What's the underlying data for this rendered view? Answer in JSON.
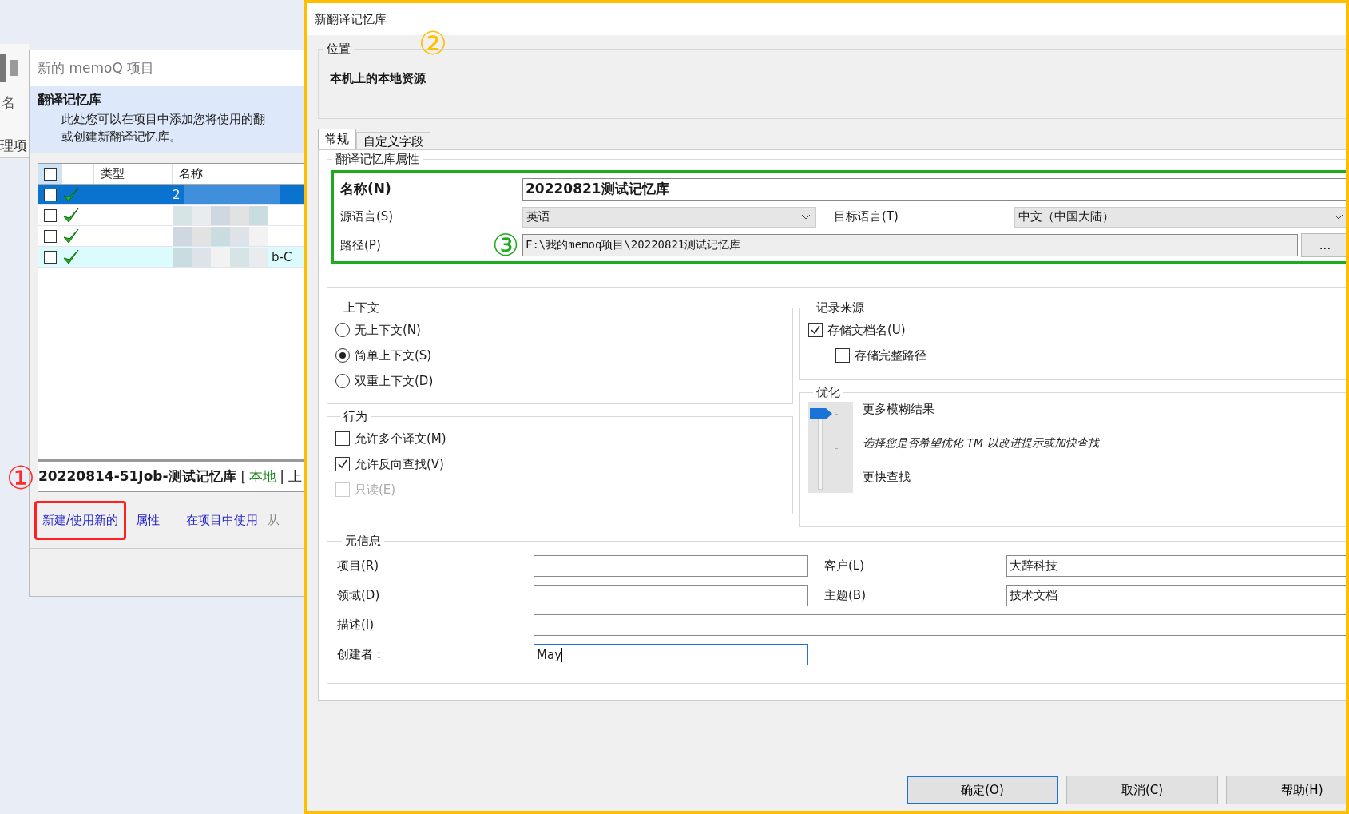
{
  "background_sidebar": {
    "items": [
      "名",
      "理项"
    ]
  },
  "background_window": {
    "title": "新的 memoQ 项目",
    "header": {
      "title": "翻译记忆库",
      "description": [
        "此处您可以在项目中添加您将使用的翻",
        "或创建新翻译记忆库。"
      ]
    },
    "table": {
      "header_checked": false,
      "columns": [
        "类型",
        "名称"
      ],
      "rows": [
        {
          "checked": false,
          "selected": true,
          "highlighted": false,
          "name": "2"
        },
        {
          "checked": false,
          "selected": false,
          "highlighted": false
        },
        {
          "checked": false,
          "selected": false,
          "highlighted": false
        },
        {
          "checked": false,
          "selected": false,
          "highlighted": true,
          "name": "b-C"
        }
      ]
    },
    "details": {
      "name": "20220814-51Job-测试记忆库",
      "bracket": "[",
      "location": "本地",
      "rest": "| 上"
    },
    "actions": [
      {
        "label": "新建/使用新的",
        "framed": true
      },
      {
        "label": "属性",
        "framed": false
      },
      {
        "label": "在项目中使用",
        "framed": false
      },
      {
        "label": "从",
        "framed": false
      }
    ]
  },
  "annotations": [
    {
      "label": "①",
      "color": "#ff2a2a"
    },
    {
      "label": "②",
      "color": "#ffc000"
    },
    {
      "label": "③",
      "color": "#1faa1f"
    }
  ],
  "dialog": {
    "title": "新翻译记忆库",
    "location": {
      "heading": "位置",
      "value": "本机上的本地资源"
    },
    "tabs": [
      {
        "label": "常规",
        "selected": true
      },
      {
        "label": "自定义字段",
        "selected": false
      }
    ],
    "properties": {
      "heading": "翻译记忆库属性",
      "name_label": "名称(N)",
      "name_value": "20220821测试记忆库",
      "source_label": "源语言(S)",
      "source_value": "英语",
      "target_label": "目标语言(T)",
      "target_value": "中文（中国大陆）",
      "path_label": "路径(P)",
      "path_value": "F:\\我的memoq项目\\20220821测试记忆库",
      "browse": "..."
    },
    "context": {
      "heading": "上下文",
      "options": [
        {
          "label": "无上下文(N)",
          "selected": false
        },
        {
          "label": "简单上下文(S)",
          "selected": true
        },
        {
          "label": "双重上下文(D)",
          "selected": false
        }
      ]
    },
    "behavior": {
      "heading": "行为",
      "options": [
        {
          "label": "允许多个译文(M)",
          "checked": false,
          "disabled": false
        },
        {
          "label": "允许反向查找(V)",
          "checked": true,
          "disabled": false
        },
        {
          "label": "只读(E)",
          "checked": false,
          "disabled": true
        }
      ]
    },
    "record_source": {
      "heading": "记录来源",
      "options": [
        {
          "label": "存储文档名(U)",
          "checked": true,
          "children": [
            {
              "label": "存储完整路径",
              "checked": false
            }
          ]
        }
      ]
    },
    "optimization": {
      "heading": "优化",
      "level": 1,
      "top_label": "更多模糊结果",
      "hint": "选择您是否希望优化 TM 以改进提示或加快查找",
      "bottom_label": "更快查找"
    },
    "meta": {
      "heading": "元信息",
      "fields": [
        {
          "label": "项目(R)",
          "wide": false
        },
        {
          "label": "客户(L)",
          "value": "大辞科技",
          "wide": false
        },
        {
          "label": "领域(D)",
          "wide": false
        },
        {
          "label": "主题(B)",
          "value": "技术文档",
          "wide": false
        },
        {
          "label": "描述(I)",
          "wide": true
        },
        {
          "label": "创建者：",
          "value": "May",
          "wide": false,
          "focused": true
        }
      ]
    },
    "buttons": [
      {
        "label": "确定(O)",
        "default": true
      },
      {
        "label": "取消(C)",
        "default": false
      },
      {
        "label": "帮助(H)",
        "default": false
      }
    ]
  }
}
